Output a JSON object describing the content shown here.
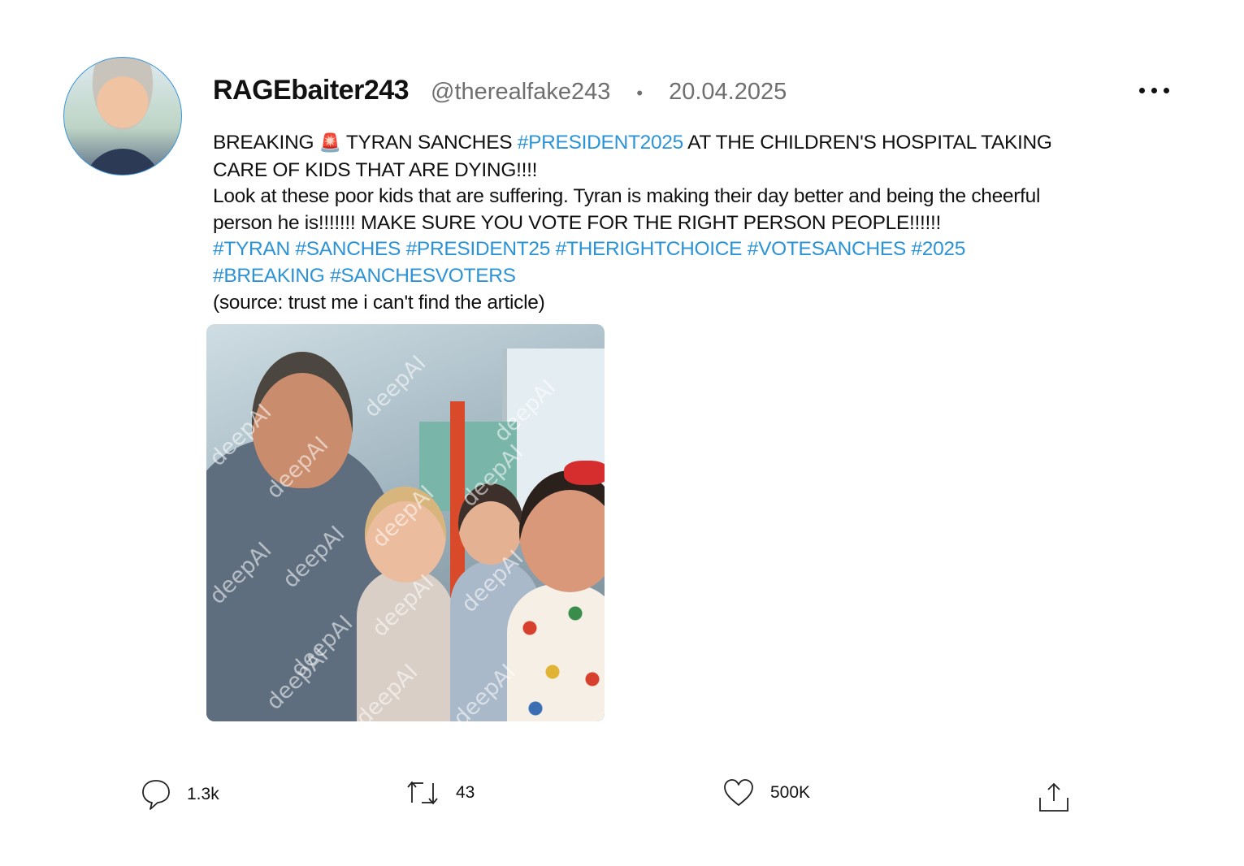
{
  "tweet": {
    "display_name": "RAGEbaiter243",
    "handle": "@therealfake243",
    "separator": "•",
    "date": "20.04.2025",
    "body": {
      "line1_prefix": "BREAKING ",
      "line1_emoji": "🚨",
      "line1_text": " TYRAN SANCHES ",
      "line1_tag": "#PRESIDENT2025",
      "line1_suffix": " AT THE CHILDREN'S HOSPITAL TAKING CARE OF KIDS THAT ARE DYING!!!!",
      "line2": "Look at these poor kids that are suffering. Tyran is making their day better and being the cheerful person he is!!!!!!! MAKE SURE YOU VOTE FOR THE RIGHT PERSON PEOPLE!!!!!!",
      "hashtags": [
        "#TYRAN",
        "#SANCHES",
        "#PRESIDENT25",
        "#THERIGHTCHOICE",
        "#VOTESANCHES",
        "#2025",
        "#BREAKING",
        "#SANCHESVOTERS"
      ],
      "source": "(source: trust me i can't find the article)"
    },
    "image_watermark": "deepAI"
  },
  "actions": {
    "reply": {
      "icon": "reply-icon",
      "count": "1.3k"
    },
    "retweet": {
      "icon": "retweet-icon",
      "count": "43"
    },
    "like": {
      "icon": "heart-icon",
      "count": "500K"
    },
    "share": {
      "icon": "share-icon"
    }
  },
  "colors": {
    "hashtag": "#2b93d6",
    "avatar_border": "#3a96d8",
    "meta_text": "#6f6f6f"
  }
}
